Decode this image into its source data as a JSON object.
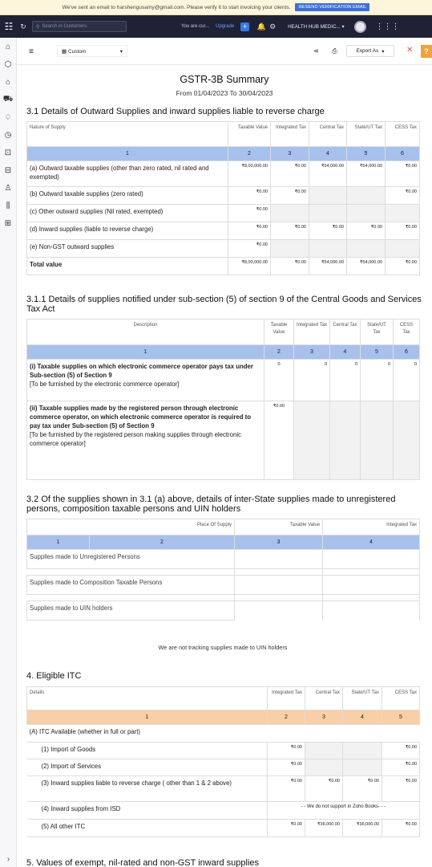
{
  "banner": {
    "text": "We've sent an email to harshengusamy@gmail.com. Please verify it to start invoicing your clients.",
    "button": "RESEND VERIFICATION EMAIL"
  },
  "topbar": {
    "search_placeholder": "Search in Customers",
    "trial": "You are cur...",
    "upgrade": "Upgrade",
    "org": "HEALTH HUB MEDIC..."
  },
  "toolbar": {
    "custom": "Custom",
    "export": "Export As",
    "help": "?"
  },
  "report": {
    "title": "GSTR-3B Summary",
    "period": "From 01/04/2023 To 30/04/2023"
  },
  "s31": {
    "heading": "3.1 Details of Outward Supplies and inward supplies liable to reverse charge",
    "cols": [
      "Nature of Supply",
      "Taxable Value",
      "Integrated Tax",
      "Central Tax",
      "State/UT Tax",
      "CESS Tax"
    ],
    "nums": [
      "1",
      "2",
      "3",
      "4",
      "5",
      "6"
    ],
    "rows": [
      {
        "label": "(a) Outward taxable supplies (other than zero rated, nil rated and exempted)",
        "v": [
          "₹8,00,000.00",
          "₹0.00",
          "₹54,000.00",
          "₹54,000.00",
          "₹0.00"
        ]
      },
      {
        "label": "(b) Outward taxable supplies (zero rated)",
        "v": [
          "₹0.00",
          "₹0.00",
          "",
          "",
          "₹0.00"
        ]
      },
      {
        "label": "(c) Other outward supplies (Nil rated, exempted)",
        "v": [
          "₹0.00",
          "",
          "",
          "",
          ""
        ]
      },
      {
        "label": "(d) Inward supplies (liable to reverse charge)",
        "v": [
          "₹0.00",
          "₹0.00",
          "₹0.00",
          "₹0.00",
          "₹0.00"
        ]
      },
      {
        "label": "(e) Non-GST outward supplies",
        "v": [
          "₹0.00",
          "",
          "",
          "",
          ""
        ]
      },
      {
        "label": "Total value",
        "v": [
          "₹8,00,000.00",
          "₹0.00",
          "₹54,000.00",
          "₹54,000.00",
          "₹0.00"
        ]
      }
    ]
  },
  "s311": {
    "heading": "3.1.1 Details of supplies notified under sub-section (5) of section 9 of the Central Goods and Services Tax Act",
    "cols": [
      "Description",
      "Taxable Value",
      "Integrated Tax",
      "Central Tax",
      "State/UT Tax",
      "CESS Tax"
    ],
    "nums": [
      "1",
      "2",
      "3",
      "4",
      "5",
      "6"
    ],
    "row1": {
      "bold": "(i) Taxable supplies on which electronic commerce operator pays tax under Sub-section (5) of Section 9",
      "note": "[To be furnished by the electronic commerce operator]",
      "v": [
        "0",
        "0",
        "0",
        "0",
        "0"
      ]
    },
    "row2": {
      "bold": "(ii) Taxable supplies made by the registered person through electronic commerce operator, on which electronic commerce operator is required to pay tax under Sub-section (5) of Section 9",
      "note": "[To be furnished by the registered person making supplies through electronic commerce operator]",
      "v": "₹0.00"
    }
  },
  "s32": {
    "heading": "3.2 Of the supplies shown in 3.1 (a) above, details of inter-State supplies made to unregistered persons, composition taxable persons and UIN holders",
    "cols": [
      "Place Of Supply",
      "Taxable Value",
      "Integrated Tax"
    ],
    "nums": [
      "1",
      "2",
      "3",
      "4"
    ],
    "rows": [
      "Supplies made to Unregistered Persons",
      "Supplies made to Composition Taxable Persons",
      "Supplies made to UIN holders"
    ],
    "note": "We are not tracking supplies made to UIN holders"
  },
  "s4": {
    "heading": "4. Eligible ITC",
    "cols": [
      "Details",
      "Integrated Tax",
      "Central Tax",
      "State/UT Tax",
      "CESS Tax"
    ],
    "nums": [
      "1",
      "2",
      "3",
      "4",
      "5"
    ],
    "a_label": "(A) ITC Available (whether in full or part)",
    "rows": [
      {
        "label": "(1) Import of Goods",
        "v": [
          "₹0.00",
          "",
          "",
          "₹0.00"
        ]
      },
      {
        "label": "(2) Import of Services",
        "v": [
          "₹0.00",
          "",
          "",
          "₹0.00"
        ]
      },
      {
        "label": "(3) Inward supplies liable to reverse charge ( other than 1 & 2 above)",
        "v": [
          "₹0.00",
          "₹0.00",
          "₹0.00",
          "₹0.00"
        ]
      },
      {
        "label": "(4) Inward supplies from ISD",
        "note": "- - We do not support in Zoho Books- - -"
      },
      {
        "label": "(5) All other ITC",
        "v": [
          "₹0.00",
          "₹36,000.00",
          "₹36,000.00",
          "₹0.00"
        ]
      }
    ]
  },
  "s5": {
    "heading": "5. Values of exempt, nil-rated and non-GST inward supplies"
  }
}
